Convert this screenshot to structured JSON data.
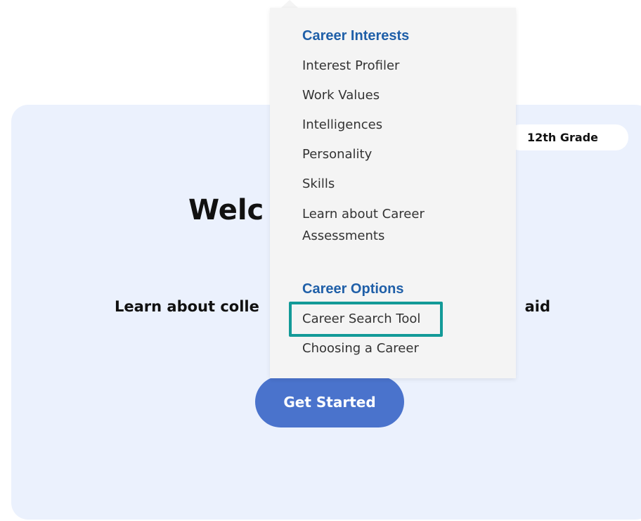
{
  "hero": {
    "grade_label": "12th Grade",
    "welcome_visible": "Welc",
    "subtitle_left": "Learn about colle",
    "subtitle_right": "aid",
    "cta_label": "Get Started"
  },
  "dropdown": {
    "sections": [
      {
        "heading": "Career Interests",
        "items": [
          "Interest Profiler",
          "Work Values",
          "Intelligences",
          "Personality",
          "Skills",
          "Learn about Career Assessments"
        ]
      },
      {
        "heading": "Career Options",
        "items": [
          "Career Search Tool",
          "Choosing a Career"
        ]
      }
    ],
    "highlighted_item": "Career Search Tool"
  },
  "colors": {
    "hero_bg": "#ebf1fd",
    "cta_bg": "#4a73cc",
    "menu_heading": "#1f5fa8",
    "menu_bg": "#f4f4f4",
    "highlight": "#139a98"
  }
}
